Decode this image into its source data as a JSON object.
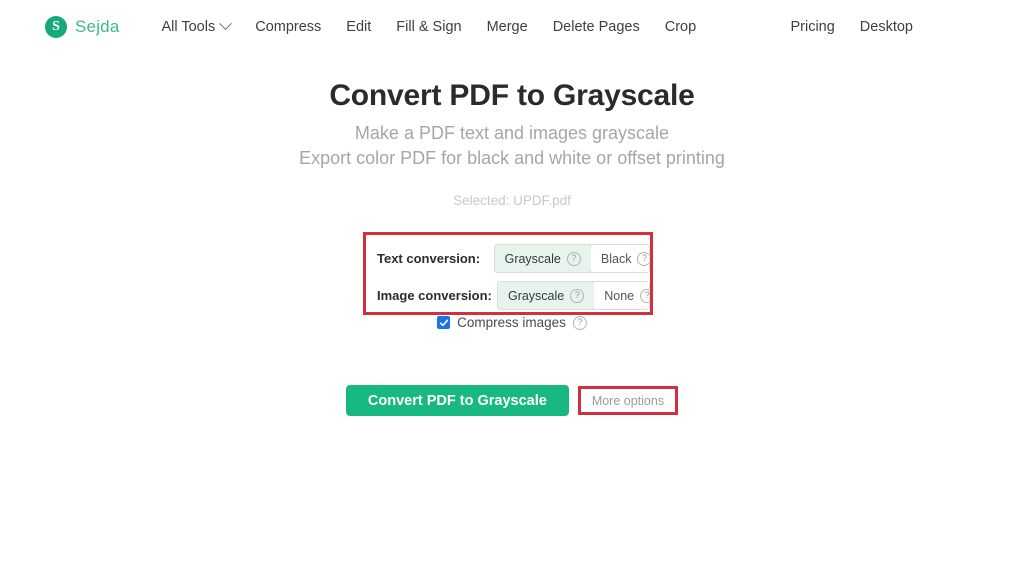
{
  "brand": {
    "mark_letter": "S",
    "name": "Sejda"
  },
  "nav": {
    "left_items": [
      {
        "label": "All Tools",
        "has_chevron": true
      },
      {
        "label": "Compress",
        "has_chevron": false
      },
      {
        "label": "Edit",
        "has_chevron": false
      },
      {
        "label": "Fill & Sign",
        "has_chevron": false
      },
      {
        "label": "Merge",
        "has_chevron": false
      },
      {
        "label": "Delete Pages",
        "has_chevron": false
      },
      {
        "label": "Crop",
        "has_chevron": false
      }
    ],
    "right_items": [
      {
        "label": "Pricing"
      },
      {
        "label": "Desktop"
      }
    ]
  },
  "hero": {
    "title": "Convert PDF to Grayscale",
    "subtitle_line1": "Make a PDF text and images grayscale",
    "subtitle_line2": "Export color PDF for black and white or offset printing"
  },
  "file": {
    "selected_text": "Selected: UPDF.pdf"
  },
  "options": {
    "text_conversion": {
      "label": "Text conversion:",
      "choices": [
        {
          "label": "Grayscale",
          "selected": true,
          "help": "?"
        },
        {
          "label": "Black",
          "selected": false,
          "help": "?"
        }
      ]
    },
    "image_conversion": {
      "label": "Image conversion:",
      "choices": [
        {
          "label": "Grayscale",
          "selected": true,
          "help": "?"
        },
        {
          "label": "None",
          "selected": false,
          "help": "?"
        }
      ]
    },
    "compress_images": {
      "label": "Compress images",
      "checked": true,
      "help": "?"
    }
  },
  "actions": {
    "convert_label": "Convert PDF to Grayscale",
    "more_options_label": "More options"
  },
  "colors": {
    "brand_green": "#3fb98a",
    "button_green": "#18b981",
    "annotation_red": "#d42f3f",
    "checkbox_blue": "#1a73e8",
    "selected_toggle_bg": "#e6f4ec",
    "selected_toggle_border": "#8fc9ab"
  }
}
